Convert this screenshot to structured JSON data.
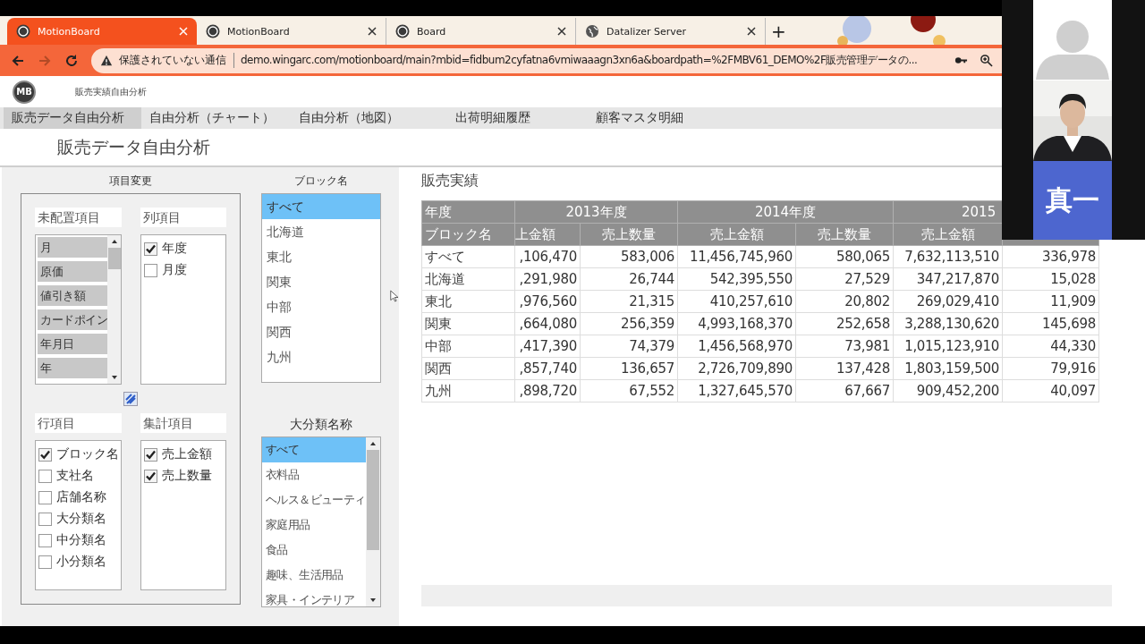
{
  "browser": {
    "tabs": [
      {
        "title": "MotionBoard",
        "selected": true
      },
      {
        "title": "MotionBoard",
        "selected": false
      },
      {
        "title": "Board",
        "selected": false
      },
      {
        "title": "Datalizer Server",
        "selected": false
      }
    ],
    "new_tab": "+",
    "security_warning": "保護されていない通信",
    "url": "demo.wingarc.com/motionboard/main?mbid=fidbum2cyfatna6vmiwaaagn3xn6a&boardpath=%2FMBV61_DEMO%2F販売管理データの..."
  },
  "app": {
    "logo": "MB",
    "breadcrumb": "販売実績自由分析",
    "menu": [
      {
        "label": "販売データ自由分析",
        "selected": true
      },
      {
        "label": "自由分析（チャート）",
        "selected": false
      },
      {
        "label": "自由分析（地図）",
        "selected": false
      },
      {
        "label": "出荷明細履歴",
        "selected": false
      },
      {
        "label": "顧客マスタ明細",
        "selected": false
      }
    ],
    "page_title": "販売データ自由分析"
  },
  "field_panel": {
    "title": "項目変更",
    "unplaced": {
      "label": "未配置項目",
      "items": [
        "月",
        "原価",
        "値引き額",
        "カードポイン",
        "年月日",
        "年"
      ]
    },
    "columns": {
      "label": "列項目",
      "items": [
        {
          "label": "年度",
          "checked": true
        },
        {
          "label": "月度",
          "checked": false
        }
      ]
    },
    "rows": {
      "label": "行項目",
      "items": [
        {
          "label": "ブロック名",
          "checked": true
        },
        {
          "label": "支社名",
          "checked": false
        },
        {
          "label": "店舗名称",
          "checked": false
        },
        {
          "label": "大分類名",
          "checked": false
        },
        {
          "label": "中分類名",
          "checked": false
        },
        {
          "label": "小分類名",
          "checked": false
        }
      ]
    },
    "measures": {
      "label": "集計項目",
      "items": [
        {
          "label": "売上金額",
          "checked": true
        },
        {
          "label": "売上数量",
          "checked": true
        }
      ]
    }
  },
  "block_filter": {
    "title": "ブロック名",
    "items": [
      {
        "label": "すべて",
        "selected": true
      },
      {
        "label": "北海道",
        "selected": false
      },
      {
        "label": "東北",
        "selected": false
      },
      {
        "label": "関東",
        "selected": false
      },
      {
        "label": "中部",
        "selected": false
      },
      {
        "label": "関西",
        "selected": false
      },
      {
        "label": "九州",
        "selected": false
      }
    ]
  },
  "category_filter": {
    "title": "大分類名称",
    "items": [
      {
        "label": "すべて",
        "selected": true
      },
      {
        "label": "衣料品",
        "selected": false
      },
      {
        "label": "ヘルス＆ビューティ",
        "selected": false
      },
      {
        "label": "家庭用品",
        "selected": false
      },
      {
        "label": "食品",
        "selected": false
      },
      {
        "label": "趣味、生活用品",
        "selected": false
      },
      {
        "label": "家具・インテリア",
        "selected": false
      }
    ]
  },
  "report": {
    "title": "販売実績",
    "corner_top": "年度",
    "corner_bottom": "ブロック名",
    "year_groups": [
      {
        "label": "2013年度",
        "columns": [
          "上金額",
          "売上数量"
        ]
      },
      {
        "label": "2014年度",
        "columns": [
          "売上金額",
          "売上数量"
        ]
      },
      {
        "label": "2015",
        "columns": [
          "売上金額"
        ]
      }
    ],
    "rows": [
      {
        "block": "すべて",
        "cells": [
          ",106,470",
          "583,006",
          "11,456,745,960",
          "580,065",
          "7,632,113,510",
          "336,978"
        ]
      },
      {
        "block": "北海道",
        "cells": [
          ",291,980",
          "26,744",
          "542,395,550",
          "27,529",
          "347,217,870",
          "15,028"
        ]
      },
      {
        "block": "東北",
        "cells": [
          ",976,560",
          "21,315",
          "410,257,610",
          "20,802",
          "269,029,410",
          "11,909"
        ]
      },
      {
        "block": "関東",
        "cells": [
          ",664,080",
          "256,359",
          "4,993,168,370",
          "252,658",
          "3,288,130,620",
          "145,698"
        ]
      },
      {
        "block": "中部",
        "cells": [
          ",417,390",
          "74,379",
          "1,456,568,970",
          "73,981",
          "1,015,123,910",
          "44,330"
        ]
      },
      {
        "block": "関西",
        "cells": [
          ",857,740",
          "136,657",
          "2,726,709,890",
          "137,428",
          "1,803,159,500",
          "79,916"
        ]
      },
      {
        "block": "九州",
        "cells": [
          ",898,720",
          "67,552",
          "1,327,645,570",
          "67,667",
          "909,452,200",
          "40,097"
        ]
      }
    ]
  },
  "participants": [
    {
      "kind": "avatar"
    },
    {
      "kind": "picture"
    },
    {
      "kind": "name",
      "name": "真一"
    }
  ]
}
